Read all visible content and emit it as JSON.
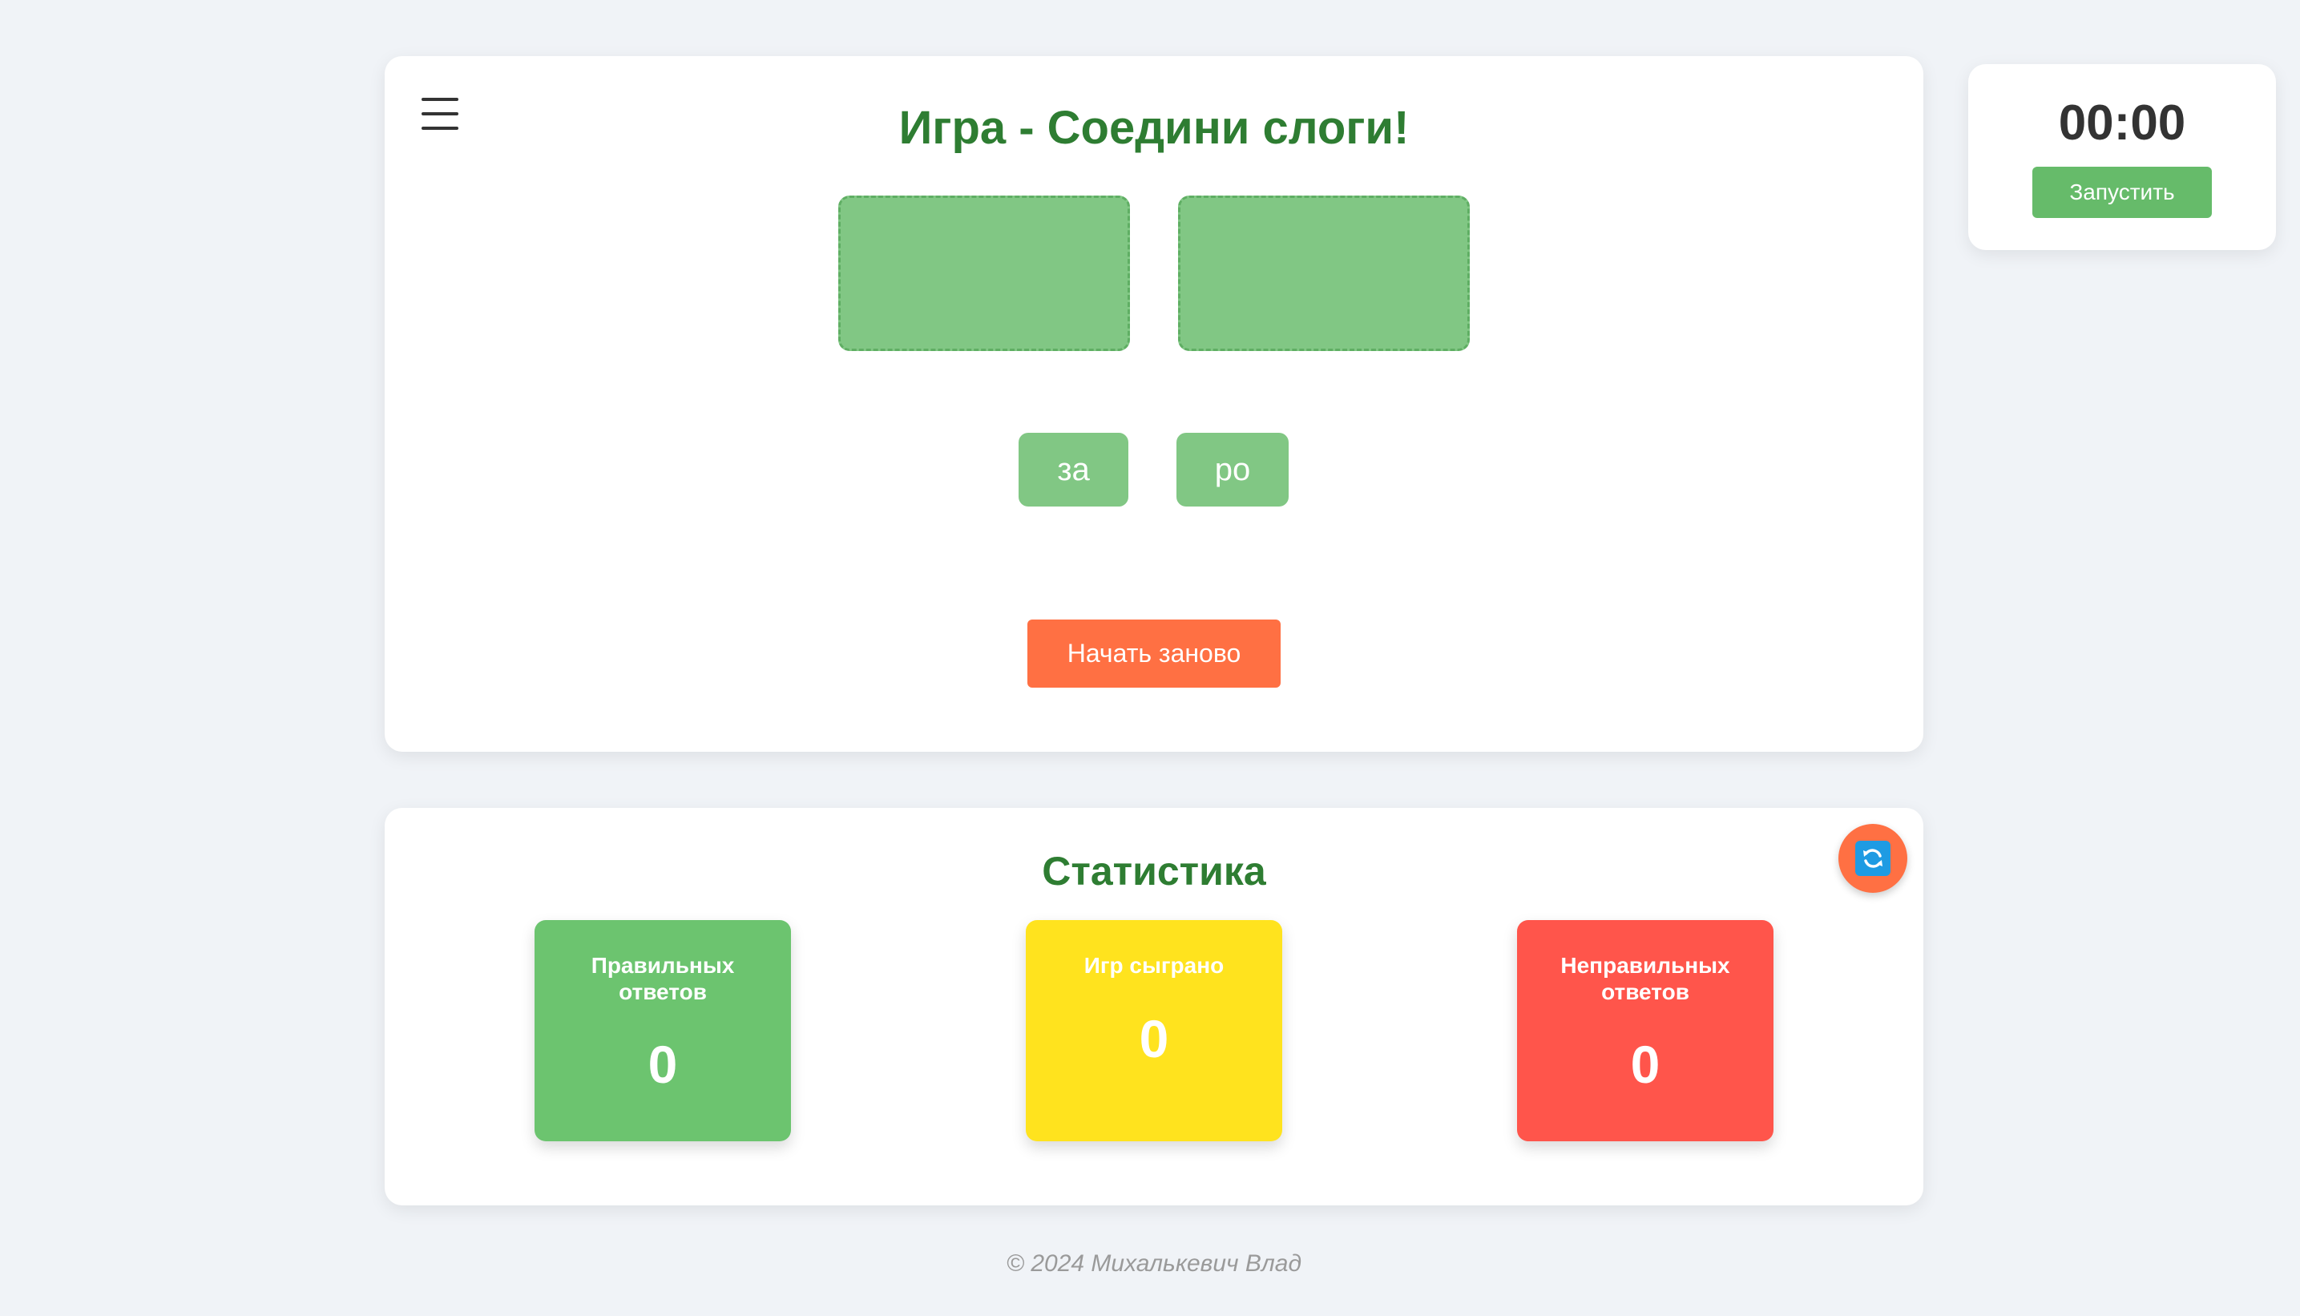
{
  "game": {
    "title": "Игра - Соедини слоги!",
    "syllables": [
      "за",
      "ро"
    ],
    "restart_label": "Начать заново"
  },
  "stats": {
    "title": "Статистика",
    "correct": {
      "label": "Правильных ответов",
      "value": "0"
    },
    "played": {
      "label": "Игр сыграно",
      "value": "0"
    },
    "wrong": {
      "label": "Неправильных ответов",
      "value": "0"
    }
  },
  "timer": {
    "display": "00:00",
    "start_label": "Запустить"
  },
  "footer": {
    "text": "© 2024 Михалькевич Влад"
  },
  "icons": {
    "menu": "menu-icon",
    "refresh": "refresh-icon"
  },
  "colors": {
    "title_green": "#2e7d32",
    "syllable_green": "#81c784",
    "restart_orange": "#ff7043",
    "stat_correct": "#6cc46f",
    "stat_played": "#ffe31e",
    "stat_wrong": "#ff554b",
    "timer_button": "#66bb6a"
  }
}
